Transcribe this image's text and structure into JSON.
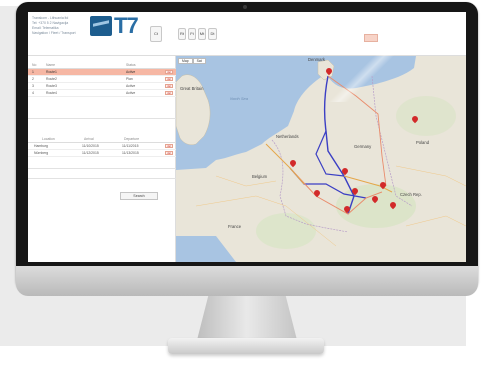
{
  "header": {
    "company_lines": [
      "Transkom - Lithuania ltd",
      "Tel: +370 5 2 Navigacija",
      "Email: Telematika",
      "Navigation / Fleet / Transport"
    ],
    "logo_text": "T7",
    "toolbar_buttons": [
      "Ct",
      "Rt",
      "Ft",
      "Mt",
      "Dt"
    ]
  },
  "routes_table": {
    "headers": [
      "No",
      "Name",
      "Status"
    ],
    "rows": [
      {
        "no": "1",
        "name": "Route1",
        "status": "Active",
        "selected": true
      },
      {
        "no": "2",
        "name": "Route2",
        "status": "Plan",
        "selected": false
      },
      {
        "no": "3",
        "name": "Route3",
        "status": "Active",
        "selected": false
      },
      {
        "no": "4",
        "name": "Route4",
        "status": "Active",
        "selected": false
      }
    ],
    "delete_label": "del"
  },
  "stops_table": {
    "headers": [
      "Location",
      "Arrival",
      "Departure"
    ],
    "rows": [
      {
        "location": "Hamburg",
        "arrival": "11/10/2015",
        "departure": "11/11/2015"
      },
      {
        "location": "Nürnberg",
        "arrival": "11/12/2015",
        "departure": "11/13/2015"
      }
    ],
    "delete_label": "del"
  },
  "search_button": "Search",
  "map": {
    "type_buttons": [
      "Map",
      "Sat"
    ],
    "labels": {
      "great_britain": "Great Britain",
      "netherlands": "Netherlands",
      "germany": "Germany",
      "poland": "Poland",
      "belgium": "Belgium",
      "france": "France",
      "czech": "Czech Rep.",
      "north_sea": "North Sea",
      "denmark": "Denmark"
    },
    "route_colors": {
      "primary": "#3b3fc4",
      "secondary": "#e98b6b",
      "tertiary": "#e5a74a"
    }
  }
}
